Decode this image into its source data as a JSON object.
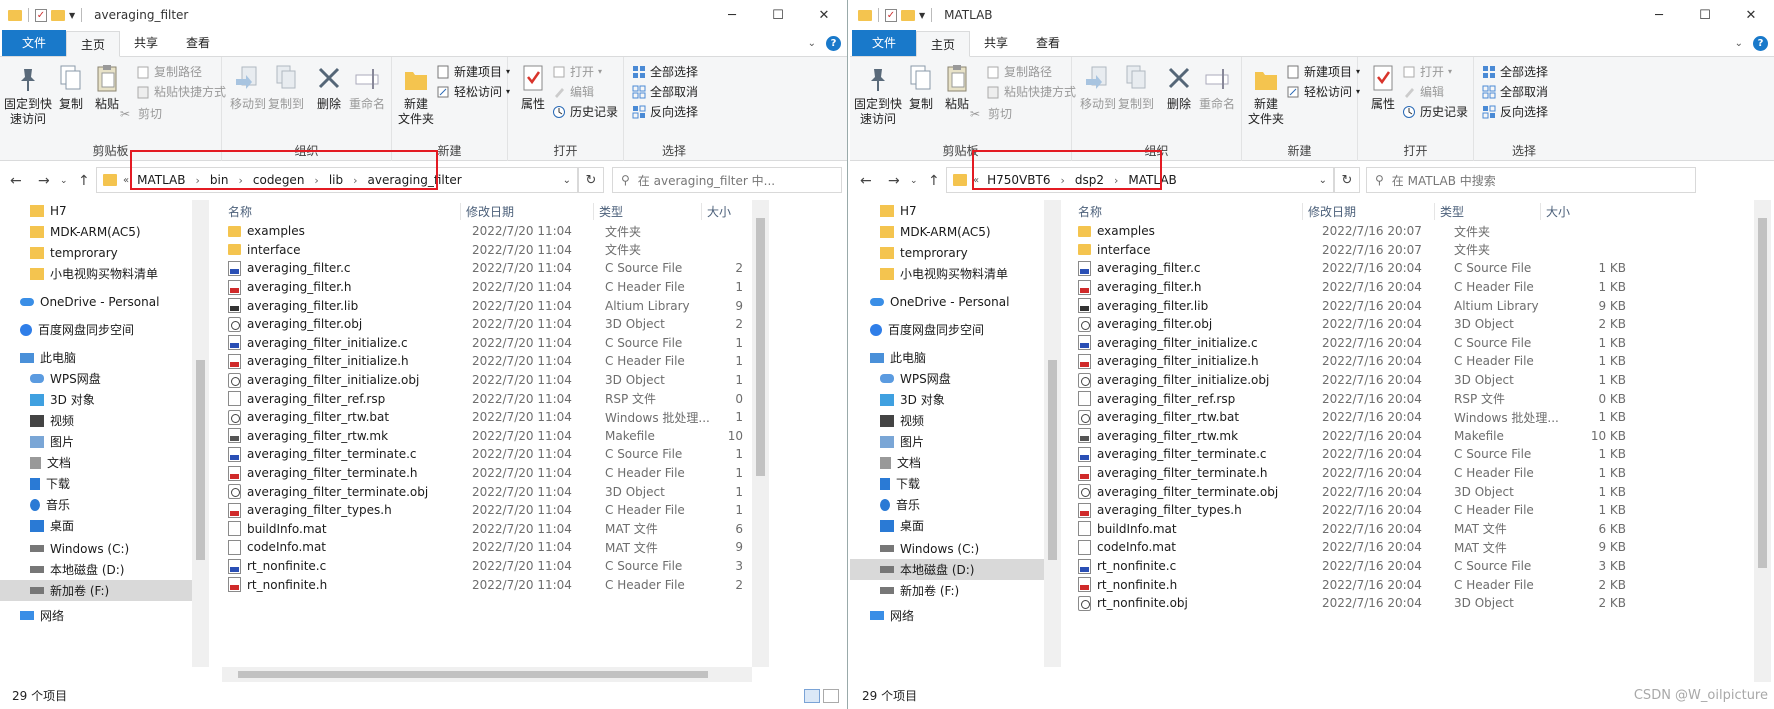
{
  "colors": {
    "file_tab": "#1979ca",
    "folder": "#f4c44f",
    "highlight_box": "#e31b23",
    "selected_nav": "#d9d9d9"
  },
  "left": {
    "title": "averaging_filter",
    "tabs": [
      "文件",
      "主页",
      "共享",
      "查看"
    ],
    "ribbon": {
      "clipboard": {
        "pin": "固定到快\n速访问",
        "copy": "复制",
        "paste": "粘贴",
        "copy_path": "复制路径",
        "paste_shortcut": "粘贴快捷方式",
        "cut": "剪切",
        "label": "剪贴板"
      },
      "organize": {
        "move_to": "移动到",
        "copy_to": "复制到",
        "delete": "删除",
        "rename": "重命名",
        "label": "组织"
      },
      "new": {
        "new_folder": "新建\n文件夹",
        "new_item": "新建项目",
        "easy_access": "轻松访问",
        "label": "新建"
      },
      "open": {
        "properties": "属性",
        "open": "打开",
        "edit": "编辑",
        "history": "历史记录",
        "label": "打开"
      },
      "select": {
        "select_all": "全部选择",
        "select_none": "全部取消",
        "invert": "反向选择",
        "label": "选择"
      }
    },
    "breadcrumb": [
      "MATLAB",
      "bin",
      "codegen",
      "lib",
      "averaging_filter"
    ],
    "search_placeholder": "在 averaging_filter 中...",
    "nav": [
      "H7",
      "MDK-ARM(AC5)",
      "temprorary",
      "小电视购买物料清单",
      "OneDrive - Personal",
      "百度网盘同步空间",
      "此电脑",
      "WPS网盘",
      "3D 对象",
      "视频",
      "图片",
      "文档",
      "下载",
      "音乐",
      "桌面",
      "Windows (C:)",
      "本地磁盘 (D:)",
      "新加卷 (F:)",
      "网络"
    ],
    "columns": {
      "name": "名称",
      "date": "修改日期",
      "type": "类型",
      "size": "大小"
    },
    "files": [
      {
        "icon": "folder",
        "name": "examples",
        "date": "2022/7/20 11:04",
        "type": "文件夹",
        "size": ""
      },
      {
        "icon": "folder",
        "name": "interface",
        "date": "2022/7/20 11:04",
        "type": "文件夹",
        "size": ""
      },
      {
        "icon": "c",
        "name": "averaging_filter.c",
        "date": "2022/7/20 11:04",
        "type": "C Source File",
        "size": "2"
      },
      {
        "icon": "h",
        "name": "averaging_filter.h",
        "date": "2022/7/20 11:04",
        "type": "C Header File",
        "size": "1"
      },
      {
        "icon": "lib",
        "name": "averaging_filter.lib",
        "date": "2022/7/20 11:04",
        "type": "Altium Library",
        "size": "9"
      },
      {
        "icon": "obj",
        "name": "averaging_filter.obj",
        "date": "2022/7/20 11:04",
        "type": "3D Object",
        "size": "2"
      },
      {
        "icon": "c",
        "name": "averaging_filter_initialize.c",
        "date": "2022/7/20 11:04",
        "type": "C Source File",
        "size": "1"
      },
      {
        "icon": "h",
        "name": "averaging_filter_initialize.h",
        "date": "2022/7/20 11:04",
        "type": "C Header File",
        "size": "1"
      },
      {
        "icon": "obj",
        "name": "averaging_filter_initialize.obj",
        "date": "2022/7/20 11:04",
        "type": "3D Object",
        "size": "1"
      },
      {
        "icon": "plain",
        "name": "averaging_filter_ref.rsp",
        "date": "2022/7/20 11:04",
        "type": "RSP 文件",
        "size": "0"
      },
      {
        "icon": "bat",
        "name": "averaging_filter_rtw.bat",
        "date": "2022/7/20 11:04",
        "type": "Windows 批处理...",
        "size": "1"
      },
      {
        "icon": "mk",
        "name": "averaging_filter_rtw.mk",
        "date": "2022/7/20 11:04",
        "type": "Makefile",
        "size": "10"
      },
      {
        "icon": "c",
        "name": "averaging_filter_terminate.c",
        "date": "2022/7/20 11:04",
        "type": "C Source File",
        "size": "1"
      },
      {
        "icon": "h",
        "name": "averaging_filter_terminate.h",
        "date": "2022/7/20 11:04",
        "type": "C Header File",
        "size": "1"
      },
      {
        "icon": "obj",
        "name": "averaging_filter_terminate.obj",
        "date": "2022/7/20 11:04",
        "type": "3D Object",
        "size": "1"
      },
      {
        "icon": "h",
        "name": "averaging_filter_types.h",
        "date": "2022/7/20 11:04",
        "type": "C Header File",
        "size": "1"
      },
      {
        "icon": "plain",
        "name": "buildInfo.mat",
        "date": "2022/7/20 11:04",
        "type": "MAT 文件",
        "size": "6"
      },
      {
        "icon": "plain",
        "name": "codeInfo.mat",
        "date": "2022/7/20 11:04",
        "type": "MAT 文件",
        "size": "9"
      },
      {
        "icon": "c",
        "name": "rt_nonfinite.c",
        "date": "2022/7/20 11:04",
        "type": "C Source File",
        "size": "3"
      },
      {
        "icon": "h",
        "name": "rt_nonfinite.h",
        "date": "2022/7/20 11:04",
        "type": "C Header File",
        "size": "2"
      }
    ],
    "status": "29 个项目"
  },
  "right": {
    "title": "MATLAB",
    "tabs": [
      "文件",
      "主页",
      "共享",
      "查看"
    ],
    "ribbon": {
      "clipboard": {
        "pin": "固定到快\n速访问",
        "copy": "复制",
        "paste": "粘贴",
        "copy_path": "复制路径",
        "paste_shortcut": "粘贴快捷方式",
        "cut": "剪切",
        "label": "剪贴板"
      },
      "organize": {
        "move_to": "移动到",
        "copy_to": "复制到",
        "delete": "删除",
        "rename": "重命名",
        "label": "组织"
      },
      "new": {
        "new_folder": "新建\n文件夹",
        "new_item": "新建项目",
        "easy_access": "轻松访问",
        "label": "新建"
      },
      "open": {
        "properties": "属性",
        "open": "打开",
        "edit": "编辑",
        "history": "历史记录",
        "label": "打开"
      },
      "select": {
        "select_all": "全部选择",
        "select_none": "全部取消",
        "invert": "反向选择",
        "label": "选择"
      }
    },
    "breadcrumb": [
      "H750VBT6",
      "dsp2",
      "MATLAB"
    ],
    "search_placeholder": "在 MATLAB 中搜索",
    "nav": [
      "H7",
      "MDK-ARM(AC5)",
      "temprorary",
      "小电视购买物料清单",
      "OneDrive - Personal",
      "百度网盘同步空间",
      "此电脑",
      "WPS网盘",
      "3D 对象",
      "视频",
      "图片",
      "文档",
      "下载",
      "音乐",
      "桌面",
      "Windows (C:)",
      "本地磁盘 (D:)",
      "新加卷 (F:)",
      "网络"
    ],
    "columns": {
      "name": "名称",
      "date": "修改日期",
      "type": "类型",
      "size": "大小"
    },
    "files": [
      {
        "icon": "folder",
        "name": "examples",
        "date": "2022/7/16 20:07",
        "type": "文件夹",
        "size": ""
      },
      {
        "icon": "folder",
        "name": "interface",
        "date": "2022/7/16 20:07",
        "type": "文件夹",
        "size": ""
      },
      {
        "icon": "c",
        "name": "averaging_filter.c",
        "date": "2022/7/16 20:04",
        "type": "C Source File",
        "size": "1 KB"
      },
      {
        "icon": "h",
        "name": "averaging_filter.h",
        "date": "2022/7/16 20:04",
        "type": "C Header File",
        "size": "1 KB"
      },
      {
        "icon": "lib",
        "name": "averaging_filter.lib",
        "date": "2022/7/16 20:04",
        "type": "Altium Library",
        "size": "9 KB"
      },
      {
        "icon": "obj",
        "name": "averaging_filter.obj",
        "date": "2022/7/16 20:04",
        "type": "3D Object",
        "size": "2 KB"
      },
      {
        "icon": "c",
        "name": "averaging_filter_initialize.c",
        "date": "2022/7/16 20:04",
        "type": "C Source File",
        "size": "1 KB"
      },
      {
        "icon": "h",
        "name": "averaging_filter_initialize.h",
        "date": "2022/7/16 20:04",
        "type": "C Header File",
        "size": "1 KB"
      },
      {
        "icon": "obj",
        "name": "averaging_filter_initialize.obj",
        "date": "2022/7/16 20:04",
        "type": "3D Object",
        "size": "1 KB"
      },
      {
        "icon": "plain",
        "name": "averaging_filter_ref.rsp",
        "date": "2022/7/16 20:04",
        "type": "RSP 文件",
        "size": "0 KB"
      },
      {
        "icon": "bat",
        "name": "averaging_filter_rtw.bat",
        "date": "2022/7/16 20:04",
        "type": "Windows 批处理...",
        "size": "1 KB"
      },
      {
        "icon": "mk",
        "name": "averaging_filter_rtw.mk",
        "date": "2022/7/16 20:04",
        "type": "Makefile",
        "size": "10 KB"
      },
      {
        "icon": "c",
        "name": "averaging_filter_terminate.c",
        "date": "2022/7/16 20:04",
        "type": "C Source File",
        "size": "1 KB"
      },
      {
        "icon": "h",
        "name": "averaging_filter_terminate.h",
        "date": "2022/7/16 20:04",
        "type": "C Header File",
        "size": "1 KB"
      },
      {
        "icon": "obj",
        "name": "averaging_filter_terminate.obj",
        "date": "2022/7/16 20:04",
        "type": "3D Object",
        "size": "1 KB"
      },
      {
        "icon": "h",
        "name": "averaging_filter_types.h",
        "date": "2022/7/16 20:04",
        "type": "C Header File",
        "size": "1 KB"
      },
      {
        "icon": "plain",
        "name": "buildInfo.mat",
        "date": "2022/7/16 20:04",
        "type": "MAT 文件",
        "size": "6 KB"
      },
      {
        "icon": "plain",
        "name": "codeInfo.mat",
        "date": "2022/7/16 20:04",
        "type": "MAT 文件",
        "size": "9 KB"
      },
      {
        "icon": "c",
        "name": "rt_nonfinite.c",
        "date": "2022/7/16 20:04",
        "type": "C Source File",
        "size": "3 KB"
      },
      {
        "icon": "h",
        "name": "rt_nonfinite.h",
        "date": "2022/7/16 20:04",
        "type": "C Header File",
        "size": "2 KB"
      },
      {
        "icon": "obj",
        "name": "rt_nonfinite.obj",
        "date": "2022/7/16 20:04",
        "type": "3D Object",
        "size": "2 KB"
      }
    ],
    "status": "29 个项目"
  },
  "watermark": "CSDN @W_oilpicture"
}
